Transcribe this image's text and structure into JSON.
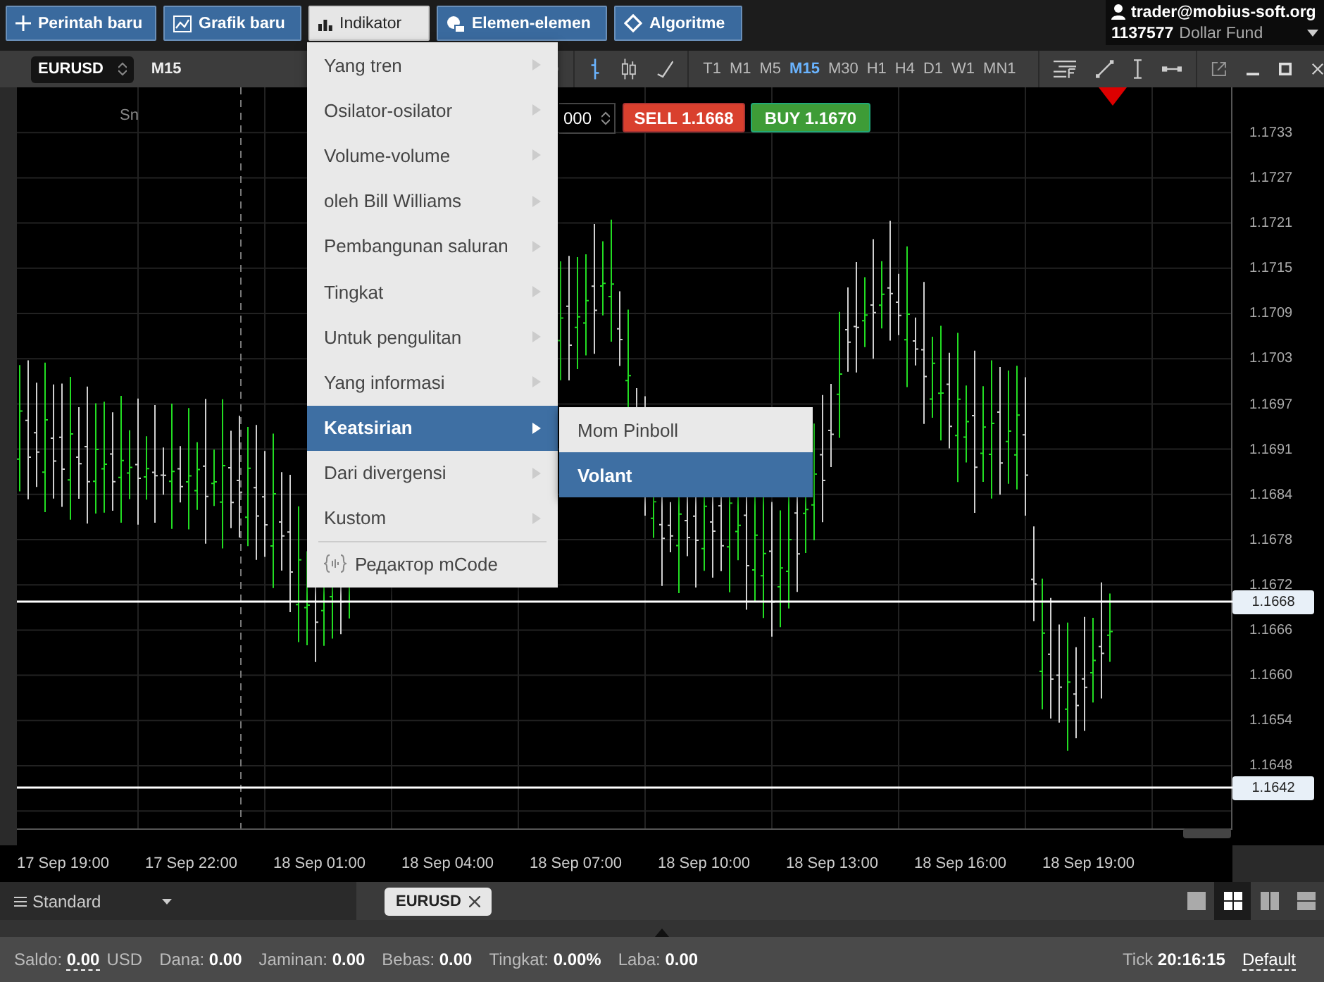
{
  "top_bar": {
    "buttons": [
      {
        "label": "Perintah baru",
        "kind": "create",
        "selected": false
      },
      {
        "label": "Grafik baru",
        "kind": "chart",
        "selected": false
      },
      {
        "label": "Indikator",
        "kind": "indicator",
        "selected": true
      },
      {
        "label": "Elemen-elemen",
        "kind": "elements",
        "selected": false
      },
      {
        "label": "Algoritme",
        "kind": "algorithm",
        "selected": false
      }
    ],
    "account": {
      "user": "trader@mobius-soft.org",
      "number": "1137577",
      "name": "Dollar Fund"
    }
  },
  "chart_window": {
    "symbol": "EURUSD",
    "timeframe": "M15",
    "timeframes": [
      {
        "label": "T1",
        "selected": false
      },
      {
        "label": "M1",
        "selected": false
      },
      {
        "label": "M5",
        "selected": false
      },
      {
        "label": "M15",
        "selected": true
      },
      {
        "label": "M30",
        "selected": false
      },
      {
        "label": "H1",
        "selected": false
      },
      {
        "label": "H4",
        "selected": false
      },
      {
        "label": "D1",
        "selected": false
      },
      {
        "label": "W1",
        "selected": false
      },
      {
        "label": "MN1",
        "selected": false
      }
    ],
    "volume": "000",
    "sell": {
      "label": "SELL",
      "price": "1.1668"
    },
    "buy": {
      "label": "BUY",
      "price": "1.1670"
    },
    "session_label": "Sn",
    "price_axis": [
      "1.1733",
      "1.1727",
      "1.1721",
      "1.1715",
      "1.1709",
      "1.1703",
      "1.1697",
      "1.1691",
      "1.1684",
      "1.1678",
      "1.1672",
      "1.1666",
      "1.1660",
      "1.1654",
      "1.1648"
    ],
    "price_lines": [
      {
        "label": "1.1668"
      },
      {
        "label": "1.1642"
      }
    ],
    "time_axis": [
      "17 Sep 19:00",
      "17 Sep 22:00",
      "18 Sep 01:00",
      "18 Sep 04:00",
      "18 Sep 07:00",
      "18 Sep 10:00",
      "18 Sep 13:00",
      "18 Sep 16:00",
      "18 Sep 19:00"
    ]
  },
  "menu": {
    "items": [
      {
        "label": "Yang tren",
        "kind": "submenu",
        "selected": false
      },
      {
        "label": "Osilator-osilator",
        "kind": "submenu",
        "selected": false
      },
      {
        "label": "Volume-volume",
        "kind": "submenu",
        "selected": false
      },
      {
        "label": "oleh Bill Williams",
        "kind": "submenu",
        "selected": false
      },
      {
        "label": "Pembangunan saluran",
        "kind": "submenu",
        "selected": false
      },
      {
        "label": "Tingkat",
        "kind": "submenu",
        "selected": false
      },
      {
        "label": "Untuk pengulitan",
        "kind": "submenu",
        "selected": false
      },
      {
        "label": "Yang informasi",
        "kind": "submenu",
        "selected": false
      },
      {
        "label": "Keatsirian",
        "kind": "submenu",
        "selected": true
      },
      {
        "label": "Dari divergensi",
        "kind": "submenu",
        "selected": false
      },
      {
        "label": "Kustom",
        "kind": "submenu",
        "selected": false
      },
      {
        "label": "Редактор mCode",
        "kind": "editor",
        "selected": false
      }
    ],
    "submenu": [
      {
        "label": "Mom Pinboll",
        "selected": false
      },
      {
        "label": "Volant",
        "selected": true
      }
    ]
  },
  "bottom_bar": {
    "layout": "Standard",
    "tab": "EURUSD",
    "layouts": [
      {
        "selected": false
      },
      {
        "selected": true
      },
      {
        "selected": false
      },
      {
        "selected": false
      }
    ]
  },
  "status_bar": {
    "fields": [
      {
        "label": "Saldo:",
        "value": "0.00",
        "unit": "USD"
      },
      {
        "label": "Dana:",
        "value": "0.00"
      },
      {
        "label": "Jaminan:",
        "value": "0.00"
      },
      {
        "label": "Bebas:",
        "value": "0.00"
      },
      {
        "label": "Tingkat:",
        "value": "0.00%"
      },
      {
        "label": "Laba:",
        "value": "0.00"
      }
    ],
    "tick_label": "Tick",
    "time": "20:16:15",
    "profile": "Default"
  }
}
